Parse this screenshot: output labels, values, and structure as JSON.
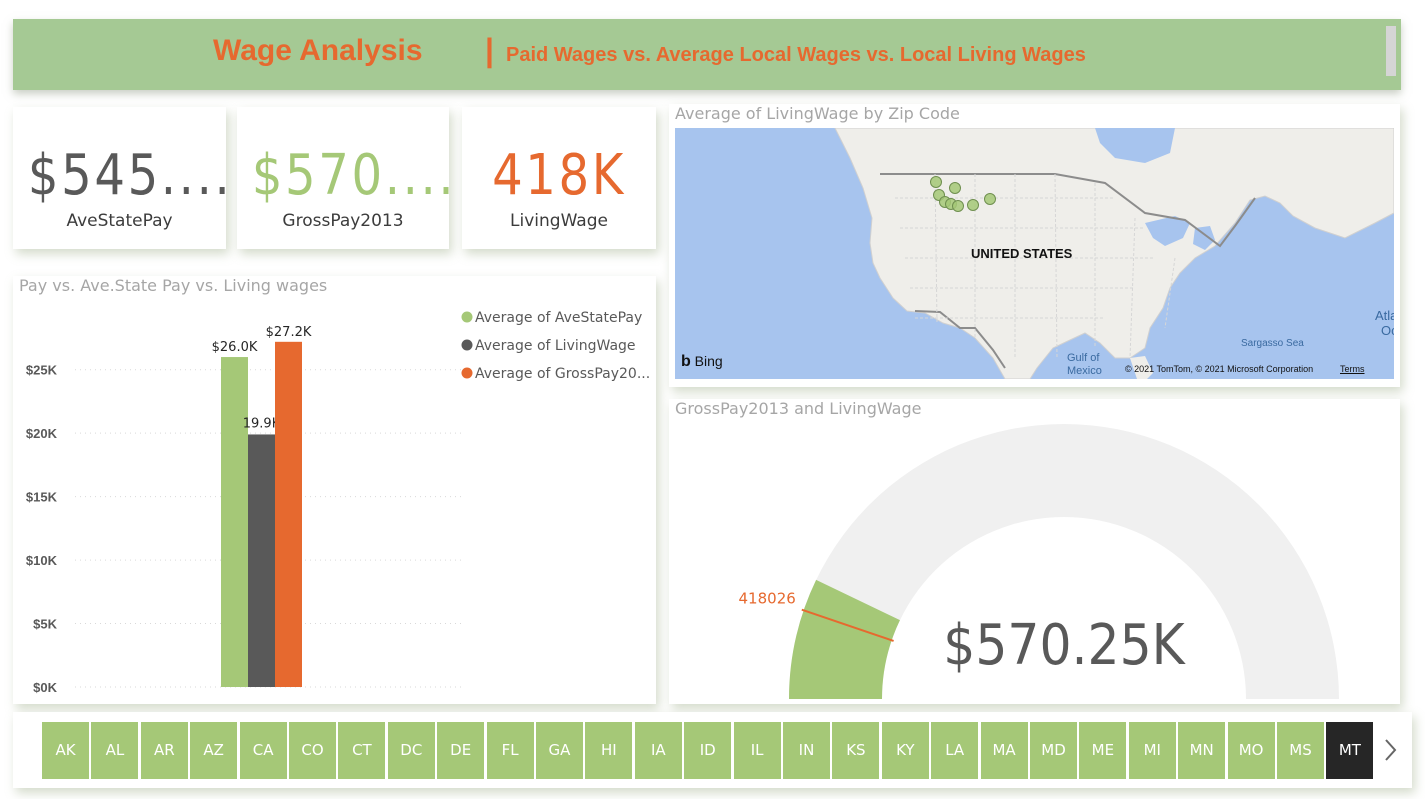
{
  "header": {
    "title": "Wage Analysis",
    "separator": "|",
    "subtitle": "Paid Wages vs. Average Local Wages vs. Local Living Wages"
  },
  "kpis": [
    {
      "value": "$545....",
      "label": "AveStatePay",
      "color": "#595959"
    },
    {
      "value": "$570....",
      "label": "GrossPay2013",
      "color": "#a5c877"
    },
    {
      "value": "418K",
      "label": "LivingWage",
      "color": "#e6692f"
    }
  ],
  "map": {
    "title": "Average of LivingWage by Zip Code",
    "country_label": "UNITED STATES",
    "gulf_label_1": "Gulf of",
    "gulf_label_2": "Mexico",
    "sea_label": "Sargasso Sea",
    "atlantic_label_1": "Atla",
    "atlantic_label_2": "Oc",
    "bing_label": "Bing",
    "copyright": "© 2021 TomTom, © 2021 Microsoft Corporation",
    "terms": "Terms",
    "marker_color": "#a5c877"
  },
  "chart_data": [
    {
      "type": "bar",
      "title": "Pay vs. Ave.State Pay vs. Living wages",
      "series": [
        {
          "name": "Average of AveStatePay",
          "legend_label": "Average of AveStatePay",
          "values": [
            26000
          ],
          "data_label": "$26.0K",
          "color": "#a5c877"
        },
        {
          "name": "Average of LivingWage",
          "legend_label": "Average of LivingWage",
          "values": [
            19900
          ],
          "data_label": "19.9K",
          "color": "#595959"
        },
        {
          "name": "Average of GrossPay2013",
          "legend_label": "Average of GrossPay20...",
          "values": [
            27200
          ],
          "data_label": "$27.2K",
          "color": "#e6692f"
        }
      ],
      "y_ticks": [
        "$0K",
        "$5K",
        "$10K",
        "$15K",
        "$20K",
        "$25K"
      ],
      "ylim": [
        0,
        27500
      ],
      "grid": true,
      "legend_position": "top-right"
    },
    {
      "type": "gauge",
      "title": "GrossPay2013 and LivingWage",
      "value": 570250,
      "value_label": "$570.25K",
      "target": 418026,
      "target_label": "418026",
      "min": 0,
      "max": 4000000,
      "fill_color": "#a5c877",
      "track_color": "#f0f0f0",
      "target_color": "#e6692f"
    }
  ],
  "slicer": {
    "states": [
      "AK",
      "AL",
      "AR",
      "AZ",
      "CA",
      "CO",
      "CT",
      "DC",
      "DE",
      "FL",
      "GA",
      "HI",
      "IA",
      "ID",
      "IL",
      "IN",
      "KS",
      "KY",
      "LA",
      "MA",
      "MD",
      "ME",
      "MI",
      "MN",
      "MO",
      "MS",
      "MT"
    ],
    "selected": "MT"
  }
}
